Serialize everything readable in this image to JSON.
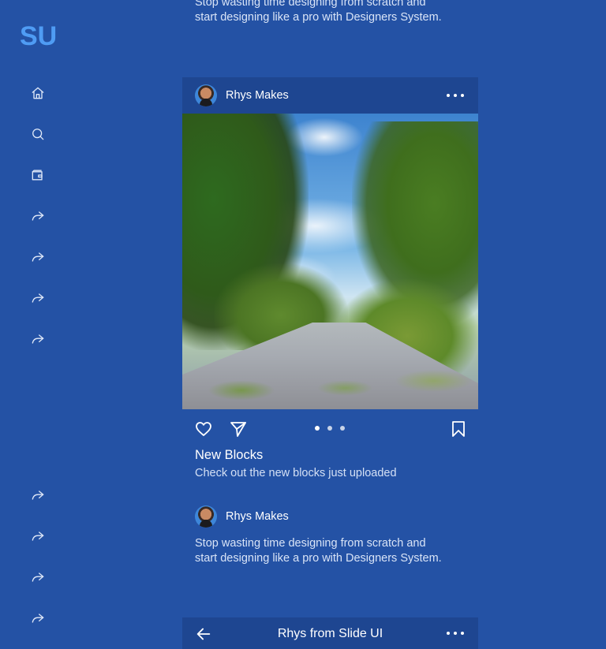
{
  "sidebar": {
    "logo": "SU",
    "items_top": [
      {
        "icon": "home-icon"
      },
      {
        "icon": "search-icon"
      },
      {
        "icon": "wallet-icon"
      },
      {
        "icon": "share-icon"
      },
      {
        "icon": "share-icon"
      },
      {
        "icon": "share-icon"
      },
      {
        "icon": "share-icon"
      }
    ],
    "items_bottom": [
      {
        "icon": "share-icon"
      },
      {
        "icon": "share-icon"
      },
      {
        "icon": "share-icon"
      },
      {
        "icon": "share-icon"
      }
    ]
  },
  "feed": {
    "top_description": [
      "Stop wasting time designing from scratch and",
      "start designing like a pro with Designers System."
    ],
    "post": {
      "author": "Rhys Makes",
      "title": "New Blocks",
      "subtitle": "Check out the new blocks just uploaded",
      "carousel": {
        "count": 3,
        "active_index": 0
      }
    },
    "second_author": "Rhys Makes",
    "second_description": [
      "Stop wasting time designing from scratch and",
      "start designing like a pro with Designers System."
    ],
    "bottom_bar": {
      "title": "Rhys from Slide UI"
    }
  },
  "colors": {
    "background": "#2452a5",
    "card": "#1e4691",
    "logo": "#4f9cf4"
  }
}
